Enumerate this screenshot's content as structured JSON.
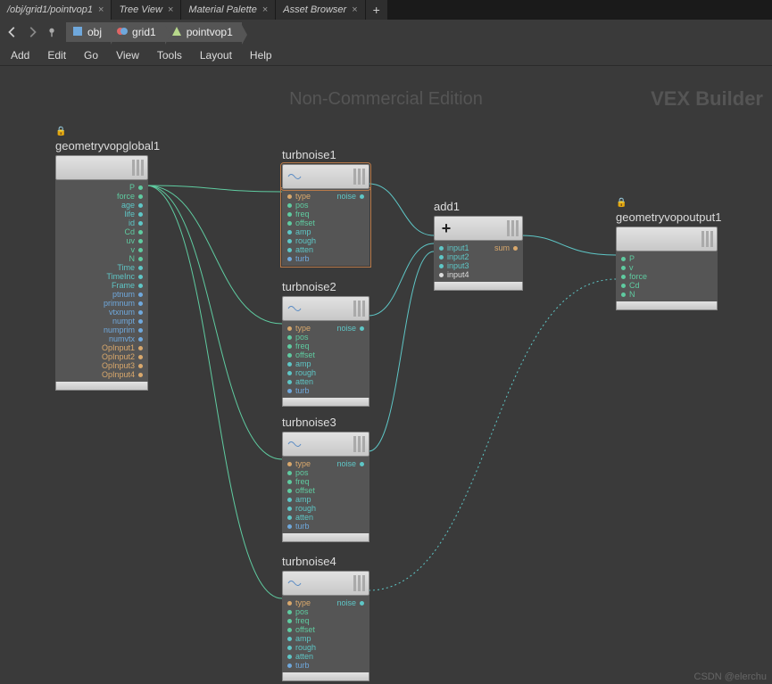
{
  "tabs": [
    {
      "label": "/obj/grid1/pointvop1",
      "active": true
    },
    {
      "label": "Tree View",
      "active": false
    },
    {
      "label": "Material Palette",
      "active": false
    },
    {
      "label": "Asset Browser",
      "active": false
    }
  ],
  "breadcrumb": {
    "obj": "obj",
    "grid1": "grid1",
    "pointvop1": "pointvop1"
  },
  "menus": [
    "Add",
    "Edit",
    "Go",
    "View",
    "Tools",
    "Layout",
    "Help"
  ],
  "watermark1": "Non-Commercial Edition",
  "watermark2": "VEX Builder",
  "bottom_watermark": "CSDN @elerchu",
  "nodes": {
    "global": {
      "title": "geometryvopglobal1",
      "outputs": [
        "P",
        "force",
        "age",
        "life",
        "id",
        "Cd",
        "uv",
        "v",
        "N",
        "Time",
        "TimeInc",
        "Frame",
        "ptnum",
        "primnum",
        "vtxnum",
        "numpt",
        "numprim",
        "numvtx",
        "OpInput1",
        "OpInput2",
        "OpInput3",
        "OpInput4"
      ],
      "output_colors": [
        "c-green",
        "c-green",
        "c-cyan",
        "c-cyan",
        "c-cyan",
        "c-green",
        "c-green",
        "c-green",
        "c-green",
        "c-cyan",
        "c-cyan",
        "c-cyan",
        "c-blue",
        "c-blue",
        "c-blue",
        "c-blue",
        "c-blue",
        "c-blue",
        "c-orange",
        "c-orange",
        "c-orange",
        "c-orange"
      ]
    },
    "turb1": {
      "title": "turbnoise1",
      "inputs": [
        "type",
        "pos",
        "freq",
        "offset",
        "amp",
        "rough",
        "atten",
        "turb"
      ],
      "output": "noise"
    },
    "turb2": {
      "title": "turbnoise2",
      "inputs": [
        "type",
        "pos",
        "freq",
        "offset",
        "amp",
        "rough",
        "atten",
        "turb"
      ],
      "output": "noise"
    },
    "turb3": {
      "title": "turbnoise3",
      "inputs": [
        "type",
        "pos",
        "freq",
        "offset",
        "amp",
        "rough",
        "atten",
        "turb"
      ],
      "output": "noise"
    },
    "turb4": {
      "title": "turbnoise4",
      "inputs": [
        "type",
        "pos",
        "freq",
        "offset",
        "amp",
        "rough",
        "atten",
        "turb"
      ],
      "output": "noise"
    },
    "add": {
      "title": "add1",
      "inputs": [
        "input1",
        "input2",
        "input3",
        "input4"
      ],
      "output": "sum"
    },
    "out": {
      "title": "geometryvopoutput1",
      "inputs": [
        "P",
        "v",
        "force",
        "Cd",
        "N"
      ],
      "input_colors": [
        "c-green",
        "c-green",
        "c-green",
        "c-green",
        "c-green"
      ]
    }
  }
}
